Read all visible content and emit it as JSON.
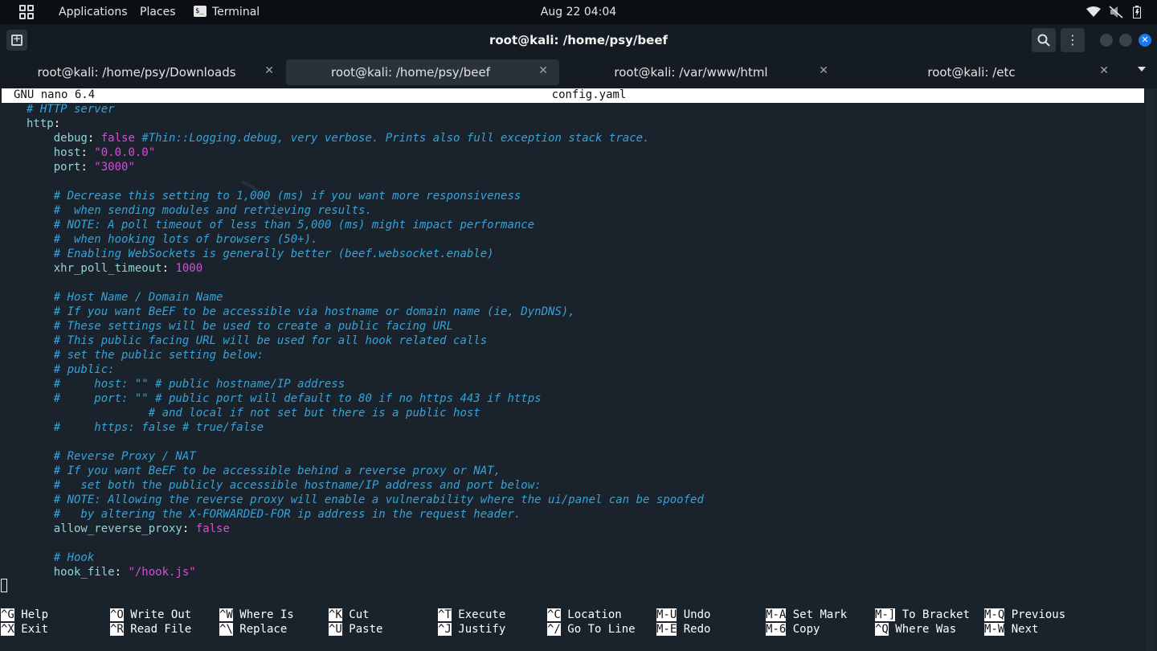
{
  "topbar": {
    "applications": "Applications",
    "places": "Places",
    "terminal": "Terminal",
    "terminal_icon_glyph": "$_",
    "clock": "Aug 22  04:04",
    "icons": [
      "wifi-icon",
      "mute-icon",
      "battery-icon"
    ]
  },
  "window": {
    "title": "root@kali: /home/psy/beef",
    "search_glyph": "⌕",
    "menu_glyph": "⋮",
    "close_glyph": "✕"
  },
  "tabs": [
    {
      "label": "root@kali: /home/psy/Downloads",
      "close": "✕",
      "active": false
    },
    {
      "label": "root@kali: /home/psy/beef",
      "close": "✕",
      "active": true
    },
    {
      "label": "root@kali: /var/www/html",
      "close": "✕",
      "active": false
    },
    {
      "label": "root@kali: /etc",
      "close": "✕",
      "active": false
    }
  ],
  "nano": {
    "version": "GNU nano 6.4",
    "filename": "config.yaml"
  },
  "editor_lines": [
    {
      "row": 1,
      "indent": "",
      "parts": [
        [
          "c",
          "# HTTP server"
        ]
      ]
    },
    {
      "row": 2,
      "indent": "",
      "parts": [
        [
          "k",
          "http"
        ],
        [
          "p",
          ":"
        ]
      ]
    },
    {
      "row": 3,
      "indent": "    ",
      "parts": [
        [
          "k",
          "debug"
        ],
        [
          "p",
          ": "
        ],
        [
          "v",
          "false"
        ],
        [
          "p",
          " "
        ],
        [
          "c",
          "#Thin::Logging.debug, very verbose. Prints also full exception stack trace."
        ]
      ]
    },
    {
      "row": 4,
      "indent": "    ",
      "parts": [
        [
          "k",
          "host"
        ],
        [
          "p",
          ": "
        ],
        [
          "v",
          "\"0.0.0.0\""
        ]
      ]
    },
    {
      "row": 5,
      "indent": "    ",
      "parts": [
        [
          "k",
          "port"
        ],
        [
          "p",
          ": "
        ],
        [
          "v",
          "\"3000\""
        ]
      ]
    },
    {
      "row": 7,
      "indent": "    ",
      "parts": [
        [
          "c",
          "# Decrease this setting to 1,000 (ms) if you want more responsiveness"
        ]
      ]
    },
    {
      "row": 8,
      "indent": "    ",
      "parts": [
        [
          "c",
          "#  when sending modules and retrieving results."
        ]
      ]
    },
    {
      "row": 9,
      "indent": "    ",
      "parts": [
        [
          "c",
          "# NOTE: A poll timeout of less than 5,000 (ms) might impact performance"
        ]
      ]
    },
    {
      "row": 10,
      "indent": "    ",
      "parts": [
        [
          "c",
          "#  when hooking lots of browsers (50+)."
        ]
      ]
    },
    {
      "row": 11,
      "indent": "    ",
      "parts": [
        [
          "c",
          "# Enabling WebSockets is generally better (beef.websocket.enable)"
        ]
      ]
    },
    {
      "row": 12,
      "indent": "    ",
      "parts": [
        [
          "k",
          "xhr_poll_timeout"
        ],
        [
          "p",
          ": "
        ],
        [
          "v",
          "1000"
        ]
      ]
    },
    {
      "row": 14,
      "indent": "    ",
      "parts": [
        [
          "c",
          "# Host Name / Domain Name"
        ]
      ]
    },
    {
      "row": 15,
      "indent": "    ",
      "parts": [
        [
          "c",
          "# If you want BeEF to be accessible via hostname or domain name (ie, DynDNS),"
        ]
      ]
    },
    {
      "row": 16,
      "indent": "    ",
      "parts": [
        [
          "c",
          "# These settings will be used to create a public facing URL"
        ]
      ]
    },
    {
      "row": 17,
      "indent": "    ",
      "parts": [
        [
          "c",
          "# This public facing URL will be used for all hook related calls"
        ]
      ]
    },
    {
      "row": 18,
      "indent": "    ",
      "parts": [
        [
          "c",
          "# set the public setting below:"
        ]
      ]
    },
    {
      "row": 19,
      "indent": "    ",
      "parts": [
        [
          "c",
          "# public:"
        ]
      ]
    },
    {
      "row": 20,
      "indent": "    ",
      "parts": [
        [
          "c",
          "#     host: \"\" # public hostname/IP address"
        ]
      ]
    },
    {
      "row": 21,
      "indent": "    ",
      "parts": [
        [
          "c",
          "#     port: \"\" # public port will default to 80 if no https 443 if https"
        ]
      ]
    },
    {
      "row": 22,
      "indent": "    ",
      "parts": [
        [
          "c",
          "              # and local if not set but there is a public host"
        ]
      ]
    },
    {
      "row": 23,
      "indent": "    ",
      "parts": [
        [
          "c",
          "#     https: false # true/false"
        ]
      ]
    },
    {
      "row": 25,
      "indent": "    ",
      "parts": [
        [
          "c",
          "# Reverse Proxy / NAT"
        ]
      ]
    },
    {
      "row": 26,
      "indent": "    ",
      "parts": [
        [
          "c",
          "# If you want BeEF to be accessible behind a reverse proxy or NAT,"
        ]
      ]
    },
    {
      "row": 27,
      "indent": "    ",
      "parts": [
        [
          "c",
          "#   set both the publicly accessible hostname/IP address and port below:"
        ]
      ]
    },
    {
      "row": 28,
      "indent": "    ",
      "parts": [
        [
          "c",
          "# NOTE: Allowing the reverse proxy will enable a vulnerability where the ui/panel can be spoofed"
        ]
      ]
    },
    {
      "row": 29,
      "indent": "    ",
      "parts": [
        [
          "c",
          "#   by altering the X-FORWARDED-FOR ip address in the request header."
        ]
      ]
    },
    {
      "row": 30,
      "indent": "    ",
      "parts": [
        [
          "k",
          "allow_reverse_proxy"
        ],
        [
          "p",
          ": "
        ],
        [
          "v",
          "false"
        ]
      ]
    },
    {
      "row": 32,
      "indent": "    ",
      "parts": [
        [
          "c",
          "# Hook"
        ]
      ]
    },
    {
      "row": 33,
      "indent": "    ",
      "parts": [
        [
          "k",
          "hook_file"
        ],
        [
          "p",
          ": "
        ],
        [
          "v",
          "\"/hook.js\""
        ]
      ]
    }
  ],
  "shortcuts": [
    {
      "key": "^G",
      "label": "Help",
      "col": 0,
      "row": 0
    },
    {
      "key": "^X",
      "label": "Exit",
      "col": 0,
      "row": 1
    },
    {
      "key": "^O",
      "label": "Write Out",
      "col": 1,
      "row": 0
    },
    {
      "key": "^R",
      "label": "Read File",
      "col": 1,
      "row": 1
    },
    {
      "key": "^W",
      "label": "Where Is",
      "col": 2,
      "row": 0
    },
    {
      "key": "^\\",
      "label": "Replace",
      "col": 2,
      "row": 1
    },
    {
      "key": "^K",
      "label": "Cut",
      "col": 3,
      "row": 0
    },
    {
      "key": "^U",
      "label": "Paste",
      "col": 3,
      "row": 1
    },
    {
      "key": "^T",
      "label": "Execute",
      "col": 4,
      "row": 0
    },
    {
      "key": "^J",
      "label": "Justify",
      "col": 4,
      "row": 1
    },
    {
      "key": "^C",
      "label": "Location",
      "col": 5,
      "row": 0
    },
    {
      "key": "^/",
      "label": "Go To Line",
      "col": 5,
      "row": 1
    },
    {
      "key": "M-U",
      "label": "Undo",
      "col": 6,
      "row": 0
    },
    {
      "key": "M-E",
      "label": "Redo",
      "col": 6,
      "row": 1
    },
    {
      "key": "M-A",
      "label": "Set Mark",
      "col": 7,
      "row": 0
    },
    {
      "key": "M-6",
      "label": "Copy",
      "col": 7,
      "row": 1
    },
    {
      "key": "M-]",
      "label": "To Bracket",
      "col": 8,
      "row": 0
    },
    {
      "key": "^Q",
      "label": "Where Was",
      "col": 8,
      "row": 1
    },
    {
      "key": "M-Q",
      "label": "Previous",
      "col": 9,
      "row": 0
    },
    {
      "key": "M-W",
      "label": "Next",
      "col": 9,
      "row": 1
    }
  ],
  "colors": {
    "comment": "#36a3d9",
    "key": "#8fd6d1",
    "value": "#d44fd6",
    "accent": "#1a78f2"
  }
}
